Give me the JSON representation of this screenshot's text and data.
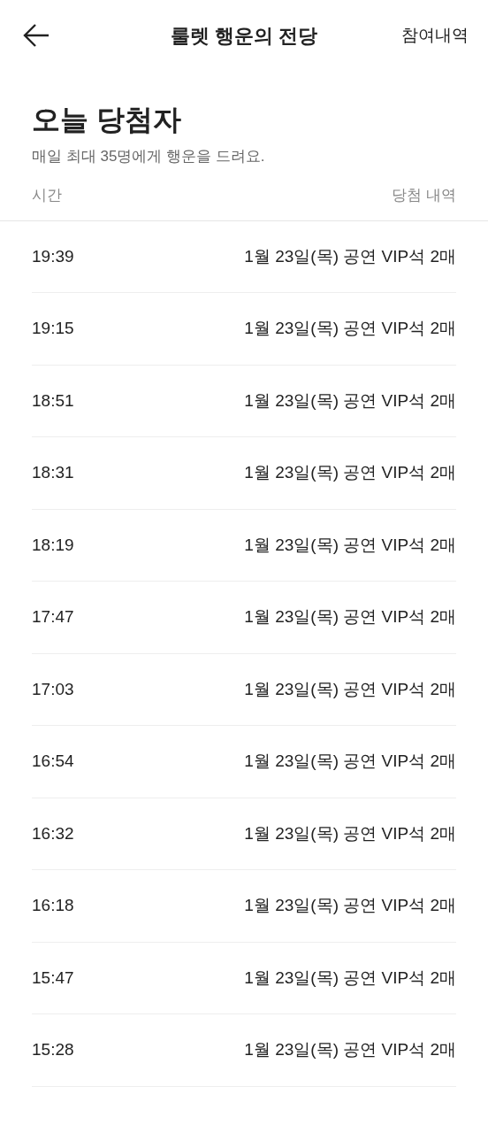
{
  "header": {
    "title": "룰렛 행운의 전당",
    "action": "참여내역"
  },
  "section": {
    "title": "오늘 당첨자",
    "subtitle": "매일 최대 35명에게 행운을 드려요."
  },
  "table": {
    "columns": [
      "시간",
      "당첨 내역"
    ],
    "rows": [
      {
        "time": "19:39",
        "prize": "1월 23일(목) 공연 VIP석 2매"
      },
      {
        "time": "19:15",
        "prize": "1월 23일(목) 공연 VIP석 2매"
      },
      {
        "time": "18:51",
        "prize": "1월 23일(목) 공연 VIP석 2매"
      },
      {
        "time": "18:31",
        "prize": "1월 23일(목) 공연 VIP석 2매"
      },
      {
        "time": "18:19",
        "prize": "1월 23일(목) 공연 VIP석 2매"
      },
      {
        "time": "17:47",
        "prize": "1월 23일(목) 공연 VIP석 2매"
      },
      {
        "time": "17:03",
        "prize": "1월 23일(목) 공연 VIP석 2매"
      },
      {
        "time": "16:54",
        "prize": "1월 23일(목) 공연 VIP석 2매"
      },
      {
        "time": "16:32",
        "prize": "1월 23일(목) 공연 VIP석 2매"
      },
      {
        "time": "16:18",
        "prize": "1월 23일(목) 공연 VIP석 2매"
      },
      {
        "time": "15:47",
        "prize": "1월 23일(목) 공연 VIP석 2매"
      },
      {
        "time": "15:28",
        "prize": "1월 23일(목) 공연 VIP석 2매"
      }
    ]
  }
}
